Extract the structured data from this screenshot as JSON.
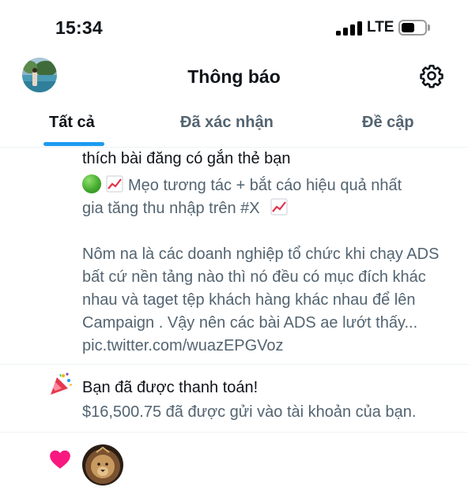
{
  "status_bar": {
    "time": "15:34",
    "network": "LTE",
    "signal_icon": "cellular-signal-icon",
    "battery_icon": "battery-icon"
  },
  "header": {
    "title": "Thông báo",
    "settings_icon": "gear-icon",
    "avatar_icon": "profile-avatar"
  },
  "tabs": [
    {
      "label": "Tất cả",
      "active": true
    },
    {
      "label": "Đã xác nhận",
      "active": false
    },
    {
      "label": "Đề cập",
      "active": false
    }
  ],
  "notifications": [
    {
      "type": "like",
      "text_top": "thích bài đăng có gắn thẻ bạn",
      "tweet_line1": "Mẹo tương tác + bắt cáo hiệu quả nhất",
      "tweet_line2": "gia tăng thu nhập trên #X",
      "tweet_para2": "Nôm na là các doanh nghiệp tổ chức khi chạy ADS bất cứ nền tảng nào thì nó đều có mục đích khác nhau và taget tệp khách hàng khác nhau để lên Campaign . Vậy nên các bài ADS ae lướt thấy... pic.twitter.com/wuazEPGVoz",
      "emoji_icons": [
        "green-circle-icon",
        "chart-increasing-icon"
      ]
    },
    {
      "type": "payment",
      "icon": "party-popper-icon",
      "title": "Bạn đã được thanh toán!",
      "subtitle": "$16,500.75 đã được gửi vào tài khoản của bạn."
    },
    {
      "type": "like",
      "icon": "heart-icon",
      "avatar": "lion-avatar"
    }
  ],
  "colors": {
    "accent": "#1d9bf0",
    "text_primary": "#0f1419",
    "text_secondary": "#536471",
    "heart": "#f91880"
  }
}
